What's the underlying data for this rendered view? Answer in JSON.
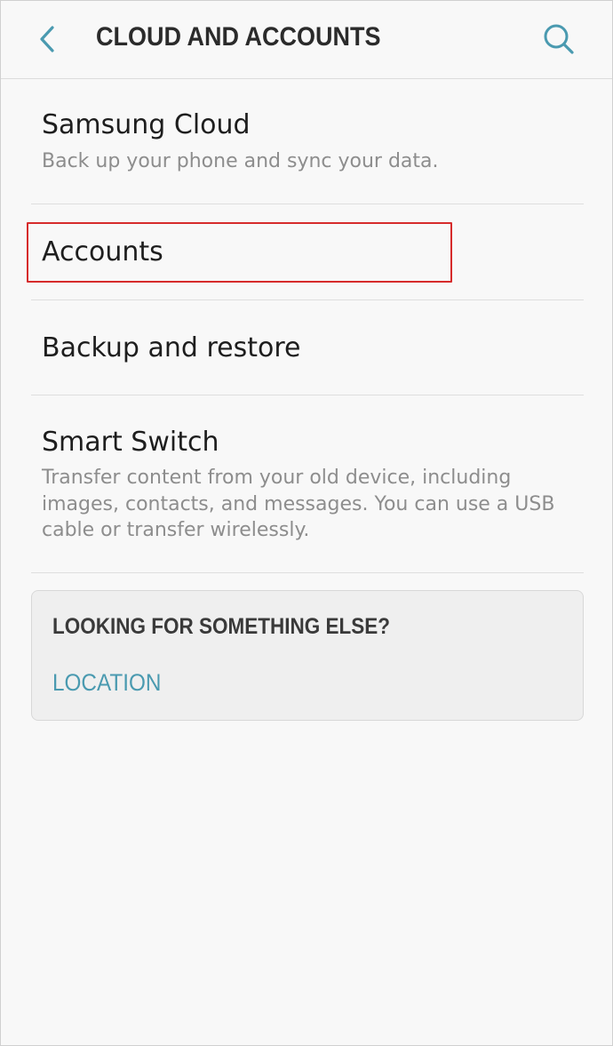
{
  "header": {
    "title": "CLOUD AND ACCOUNTS",
    "back_icon": "chevron-left-icon",
    "search_icon": "search-icon",
    "accent_color": "#4a9ab0"
  },
  "items": [
    {
      "title": "Samsung Cloud",
      "subtitle": "Back up your phone and sync your data."
    },
    {
      "title": "Accounts"
    },
    {
      "title": "Backup and restore"
    },
    {
      "title": "Smart Switch",
      "subtitle_lines": [
        "Transfer content from your old device, including",
        "images, contacts, and messages. You can use a USB",
        "cable or transfer wirelessly."
      ]
    }
  ],
  "suggestions": {
    "title": "LOOKING FOR SOMETHING ELSE?",
    "link": "LOCATION"
  },
  "highlight_color": "#d62b2b"
}
